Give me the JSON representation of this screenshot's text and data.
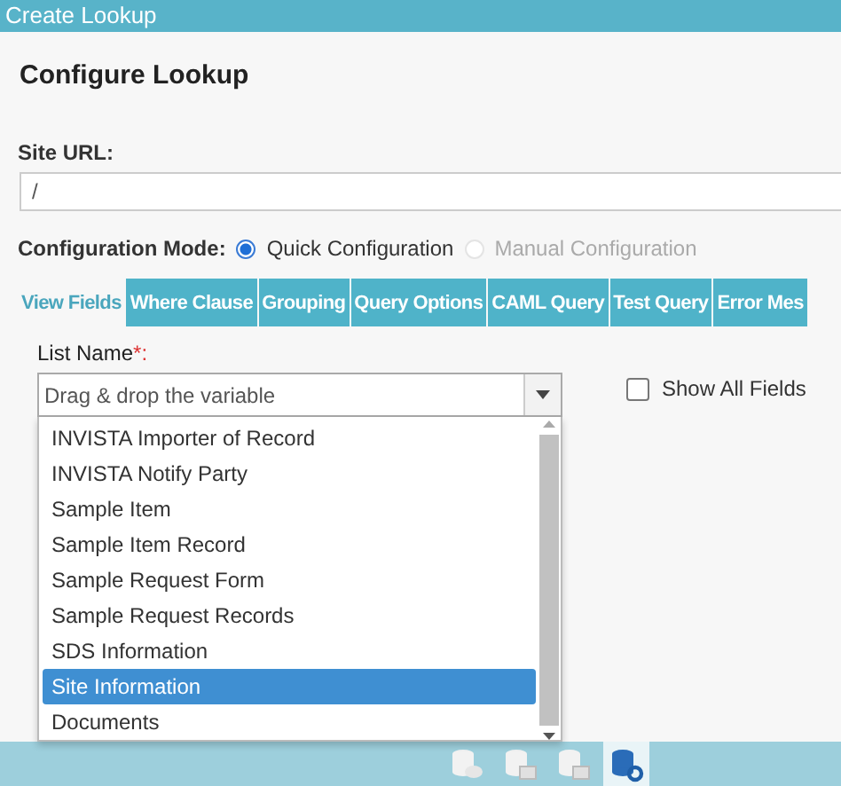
{
  "window": {
    "title": "Create Lookup"
  },
  "heading": "Configure Lookup",
  "site_url": {
    "label": "Site URL:",
    "value": "/"
  },
  "configuration_mode": {
    "label": "Configuration Mode:",
    "options": [
      {
        "label": "Quick Configuration",
        "selected": true,
        "disabled": false
      },
      {
        "label": "Manual Configuration",
        "selected": false,
        "disabled": true
      }
    ]
  },
  "tabs": [
    {
      "label": "View Fields",
      "selected": true
    },
    {
      "label": "Where Clause",
      "selected": false
    },
    {
      "label": "Grouping",
      "selected": false
    },
    {
      "label": "Query Options",
      "selected": false
    },
    {
      "label": "CAML Query",
      "selected": false
    },
    {
      "label": "Test Query",
      "selected": false
    },
    {
      "label": "Error Mes",
      "selected": false
    }
  ],
  "list_name": {
    "label": "List Name",
    "required_mark": "*:",
    "placeholder": "Drag & drop the variable",
    "expanded": true,
    "options": [
      {
        "label": "INVISTA Importer of Record",
        "selected": false
      },
      {
        "label": "INVISTA Notify Party",
        "selected": false
      },
      {
        "label": "Sample Item",
        "selected": false
      },
      {
        "label": "Sample Item Record",
        "selected": false
      },
      {
        "label": "Sample Request Form",
        "selected": false
      },
      {
        "label": "Sample Request Records",
        "selected": false
      },
      {
        "label": "SDS Information",
        "selected": false
      },
      {
        "label": "Site Information",
        "selected": true
      },
      {
        "label": "Documents",
        "selected": false
      }
    ]
  },
  "show_all_fields": {
    "label": "Show All Fields",
    "checked": false
  },
  "bottom_bar": {
    "items": [
      {
        "kind": "db",
        "selected": false
      },
      {
        "kind": "table",
        "selected": false
      },
      {
        "kind": "table",
        "selected": false
      },
      {
        "kind": "gear",
        "selected": true
      }
    ]
  }
}
